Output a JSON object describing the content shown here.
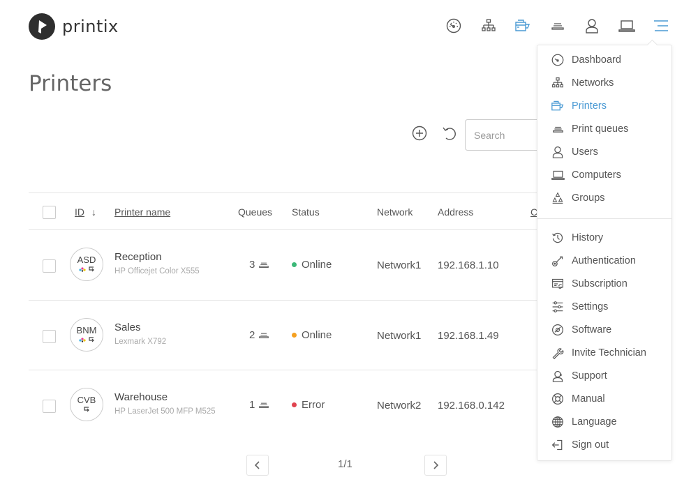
{
  "app": {
    "brand": "printix"
  },
  "topnav": {
    "items": [
      {
        "name": "dashboard",
        "icon": "dashboard-gauge-icon",
        "active": false
      },
      {
        "name": "networks",
        "icon": "network-tree-icon",
        "active": false
      },
      {
        "name": "printers",
        "icon": "printer-icon",
        "active": true
      },
      {
        "name": "print-queues",
        "icon": "print-queue-icon",
        "active": false
      },
      {
        "name": "users",
        "icon": "user-icon",
        "active": false
      },
      {
        "name": "computers",
        "icon": "laptop-icon",
        "active": false
      },
      {
        "name": "menu",
        "icon": "hamburger-menu-icon",
        "active": true
      }
    ]
  },
  "page": {
    "title": "Printers"
  },
  "toolbar": {
    "add_icon": "add-circle-icon",
    "refresh_icon": "refresh-icon",
    "search_placeholder": "Search",
    "search_value": ""
  },
  "table": {
    "columns": {
      "id": "ID",
      "sort_indicator": "↓",
      "name": "Printer name",
      "queues": "Queues",
      "status": "Status",
      "network": "Network",
      "address": "Address",
      "truncated": "C"
    },
    "rows": [
      {
        "abbr": "ASD",
        "name": "Reception",
        "model": "HP Officejet Color X555",
        "queues": "3",
        "status": "Online",
        "status_color": "#3cb878",
        "network": "Network1",
        "address": "192.168.1.10",
        "color": true
      },
      {
        "abbr": "BNM",
        "name": "Sales",
        "model": "Lexmark X792",
        "queues": "2",
        "status": "Online",
        "status_color": "#f5a020",
        "network": "Network1",
        "address": "192.168.1.49",
        "color": true
      },
      {
        "abbr": "CVB",
        "name": "Warehouse",
        "model": "HP LaserJet 500 MFP M525",
        "queues": "1",
        "status": "Error",
        "status_color": "#e0434f",
        "network": "Network2",
        "address": "192.168.0.142",
        "color": false
      }
    ]
  },
  "pagination": {
    "current": "1/1",
    "prev_icon": "chevron-left-icon",
    "next_icon": "chevron-right-icon"
  },
  "menu": {
    "items": [
      {
        "label": "Dashboard",
        "icon": "dashboard-gauge-icon",
        "active": false
      },
      {
        "label": "Networks",
        "icon": "network-tree-icon",
        "active": false
      },
      {
        "label": "Printers",
        "icon": "printer-icon",
        "active": true
      },
      {
        "label": "Print queues",
        "icon": "print-queue-icon",
        "active": false
      },
      {
        "label": "Users",
        "icon": "user-icon",
        "active": false
      },
      {
        "label": "Computers",
        "icon": "laptop-icon",
        "active": false
      },
      {
        "label": "Groups",
        "icon": "groups-icon",
        "active": false
      },
      {
        "label": "History",
        "icon": "history-icon",
        "active": false
      },
      {
        "label": "Authentication",
        "icon": "key-icon",
        "active": false
      },
      {
        "label": "Subscription",
        "icon": "subscription-icon",
        "active": false
      },
      {
        "label": "Settings",
        "icon": "sliders-icon",
        "active": false
      },
      {
        "label": "Software",
        "icon": "software-disc-icon",
        "active": false
      },
      {
        "label": "Invite Technician",
        "icon": "wrench-icon",
        "active": false
      },
      {
        "label": "Support",
        "icon": "support-headset-icon",
        "active": false
      },
      {
        "label": "Manual",
        "icon": "lifebuoy-icon",
        "active": false
      },
      {
        "label": "Language",
        "icon": "globe-icon",
        "active": false
      },
      {
        "label": "Sign out",
        "icon": "sign-out-icon",
        "active": false
      }
    ]
  },
  "colors": {
    "accent": "#4a9ad4",
    "text": "#555555",
    "online": "#3cb878",
    "warning": "#f5a020",
    "error": "#e0434f"
  }
}
